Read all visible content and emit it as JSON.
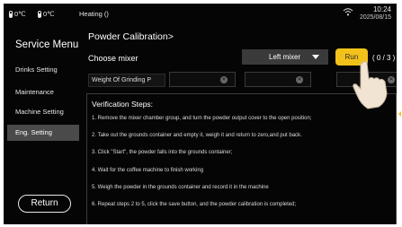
{
  "status_bar": {
    "temp1": "0℃",
    "temp2": "0℃",
    "heating": "Heating ()",
    "time": "10:24",
    "date": "2025/08/15"
  },
  "sidebar": {
    "title": "Service Menu",
    "items": [
      {
        "label": "Drinks Setting",
        "active": false
      },
      {
        "label": "Maintenance",
        "active": false
      },
      {
        "label": "Machine Setting",
        "active": false
      },
      {
        "label": "Eng. Setting",
        "active": true
      }
    ],
    "return_label": "Return"
  },
  "main": {
    "title": "Powder Calibration>",
    "mixer_label": "Choose mixer",
    "mixer_value": "Left mixer",
    "run_label": "Run",
    "progress": "( 0 / 3 )",
    "weight_label": "Weight Of Grinding P",
    "steps_title": "Verification Steps:",
    "steps": [
      "1. Remove the mixer chamber group, and turn the powder output cover to the open position;",
      "2. Take out the grounds container and empty it, weigh it and return to zero,and put back.",
      "3. Click \"Start\", the powder falls into the grounds container;",
      "4. Wait for the coffee machine to finish working",
      "5. Weigh the powder in the grounds container and record it in the machine",
      "6. Repeat steps 2 to 5, click the save button, and the powder calibration is completed;"
    ]
  },
  "colors": {
    "background": "#050505",
    "accent": "#f3c21a",
    "active_item": "#4a4a4a"
  }
}
